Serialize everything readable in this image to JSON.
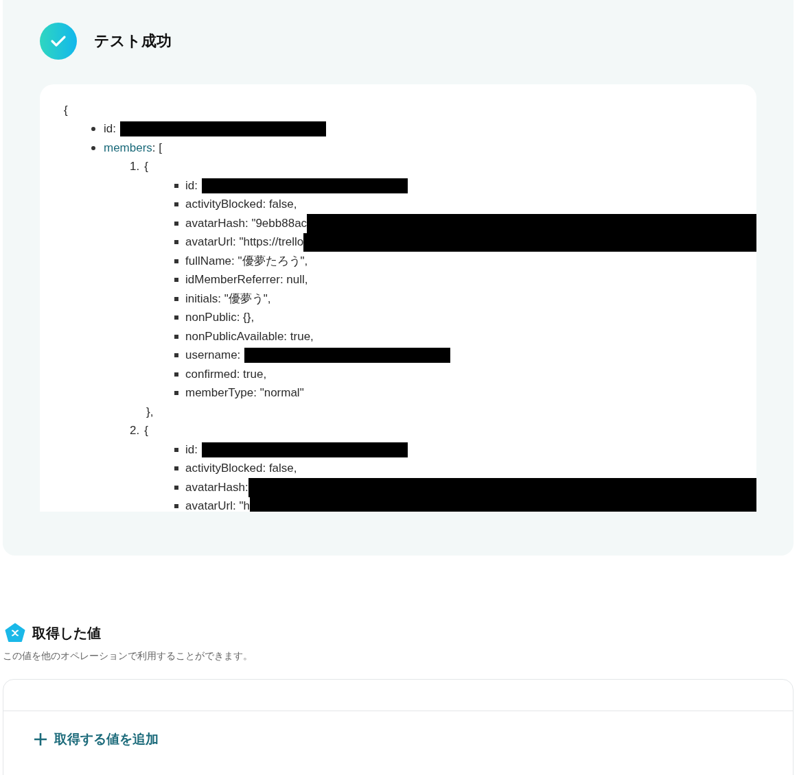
{
  "test_result": {
    "status": "テスト成功",
    "output": {
      "open": "{",
      "children": [
        {
          "kind": "masked",
          "label": "id:"
        },
        {
          "kind": "plain",
          "key": "members",
          "label": ": [",
          "children": [
            {
              "marker": "1.",
              "label": "{",
              "close": "},",
              "children": [
                {
                  "kind": "masked",
                  "label": "id:"
                },
                {
                  "kind": "plain",
                  "label": "activityBlocked: false,"
                },
                {
                  "kind": "blackout",
                  "label": "avatarHash: \"9ebb88ac"
                },
                {
                  "kind": "blackout",
                  "label": "avatarUrl: \"https://trello"
                },
                {
                  "kind": "plain",
                  "label": "fullName: \"優夢たろう\","
                },
                {
                  "kind": "plain",
                  "label": "idMemberReferrer: null,"
                },
                {
                  "kind": "plain",
                  "label": "initials: \"優夢う\","
                },
                {
                  "kind": "plain",
                  "label": "nonPublic: {},"
                },
                {
                  "kind": "plain",
                  "label": "nonPublicAvailable: true,"
                },
                {
                  "kind": "masked",
                  "label": "username:"
                },
                {
                  "kind": "plain",
                  "label": "confirmed: true,"
                },
                {
                  "kind": "plain",
                  "label": "memberType: \"normal\""
                }
              ]
            },
            {
              "marker": "2.",
              "label": "{",
              "children": [
                {
                  "kind": "masked",
                  "label": "id:"
                },
                {
                  "kind": "plain",
                  "label": "activityBlocked: false,"
                },
                {
                  "kind": "blackout",
                  "label": "avatarHash:"
                },
                {
                  "kind": "blackout",
                  "label": "avatarUrl: \"h"
                }
              ]
            }
          ]
        }
      ]
    }
  },
  "values_section": {
    "title": "取得した値",
    "description": "この値を他のオペレーションで利用することができます。",
    "add_button": "取得する値を追加"
  }
}
